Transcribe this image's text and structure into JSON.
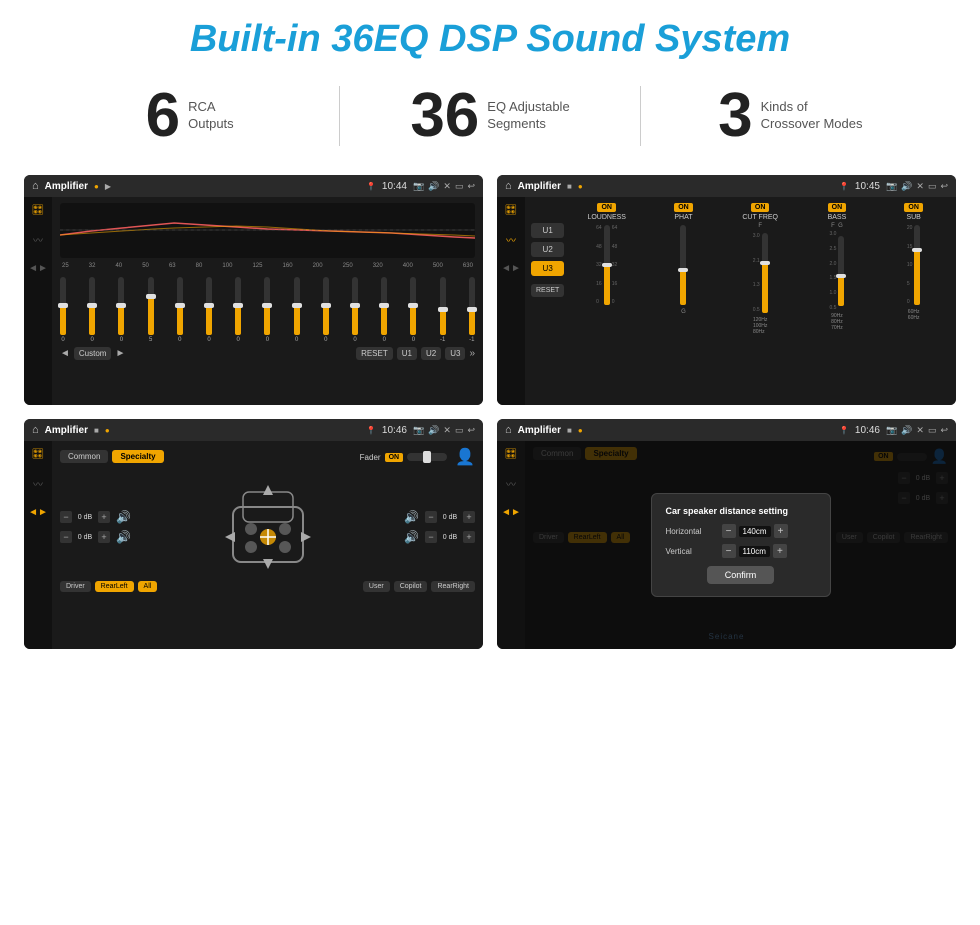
{
  "header": {
    "title": "Built-in 36EQ DSP Sound System"
  },
  "stats": [
    {
      "number": "6",
      "text_line1": "RCA",
      "text_line2": "Outputs"
    },
    {
      "number": "36",
      "text_line1": "EQ Adjustable",
      "text_line2": "Segments"
    },
    {
      "number": "3",
      "text_line1": "Kinds of",
      "text_line2": "Crossover Modes"
    }
  ],
  "screens": {
    "screen1": {
      "topbar": {
        "title": "Amplifier",
        "time": "10:44"
      },
      "eq_freqs": [
        "25",
        "32",
        "40",
        "50",
        "63",
        "80",
        "100",
        "125",
        "160",
        "200",
        "250",
        "320",
        "400",
        "500",
        "630"
      ],
      "eq_values": [
        "0",
        "0",
        "0",
        "5",
        "0",
        "0",
        "0",
        "0",
        "0",
        "0",
        "0",
        "0",
        "0",
        "-1",
        "-1"
      ],
      "buttons": [
        "Custom",
        "RESET",
        "U1",
        "U2",
        "U3"
      ]
    },
    "screen2": {
      "topbar": {
        "title": "Amplifier",
        "time": "10:45"
      },
      "u_buttons": [
        "U1",
        "U2",
        "U3"
      ],
      "columns": [
        "LOUDNESS",
        "PHAT",
        "CUT FREQ",
        "BASS",
        "SUB"
      ],
      "reset_label": "RESET"
    },
    "screen3": {
      "topbar": {
        "title": "Amplifier",
        "time": "10:46"
      },
      "tabs": [
        "Common",
        "Specialty"
      ],
      "fader_label": "Fader",
      "fader_on": "ON",
      "zones": {
        "front_left": "0 dB",
        "front_right": "0 dB",
        "rear_left": "0 dB",
        "rear_right": "0 dB"
      },
      "bottom_buttons": [
        "Driver",
        "RearLeft",
        "All",
        "User",
        "Copilot",
        "RearRight"
      ]
    },
    "screen4": {
      "topbar": {
        "title": "Amplifier",
        "time": "10:46"
      },
      "tabs": [
        "Common",
        "Specialty"
      ],
      "dialog": {
        "title": "Car speaker distance setting",
        "horizontal_label": "Horizontal",
        "horizontal_value": "140cm",
        "vertical_label": "Vertical",
        "vertical_value": "110cm",
        "confirm_label": "Confirm"
      },
      "right_values": {
        "top": "0 dB",
        "bottom": "0 dB"
      },
      "bottom_buttons": [
        "Driver",
        "RearLeft",
        "All",
        "User",
        "Copilot",
        "RearRight"
      ]
    }
  },
  "watermark": "Seicane"
}
